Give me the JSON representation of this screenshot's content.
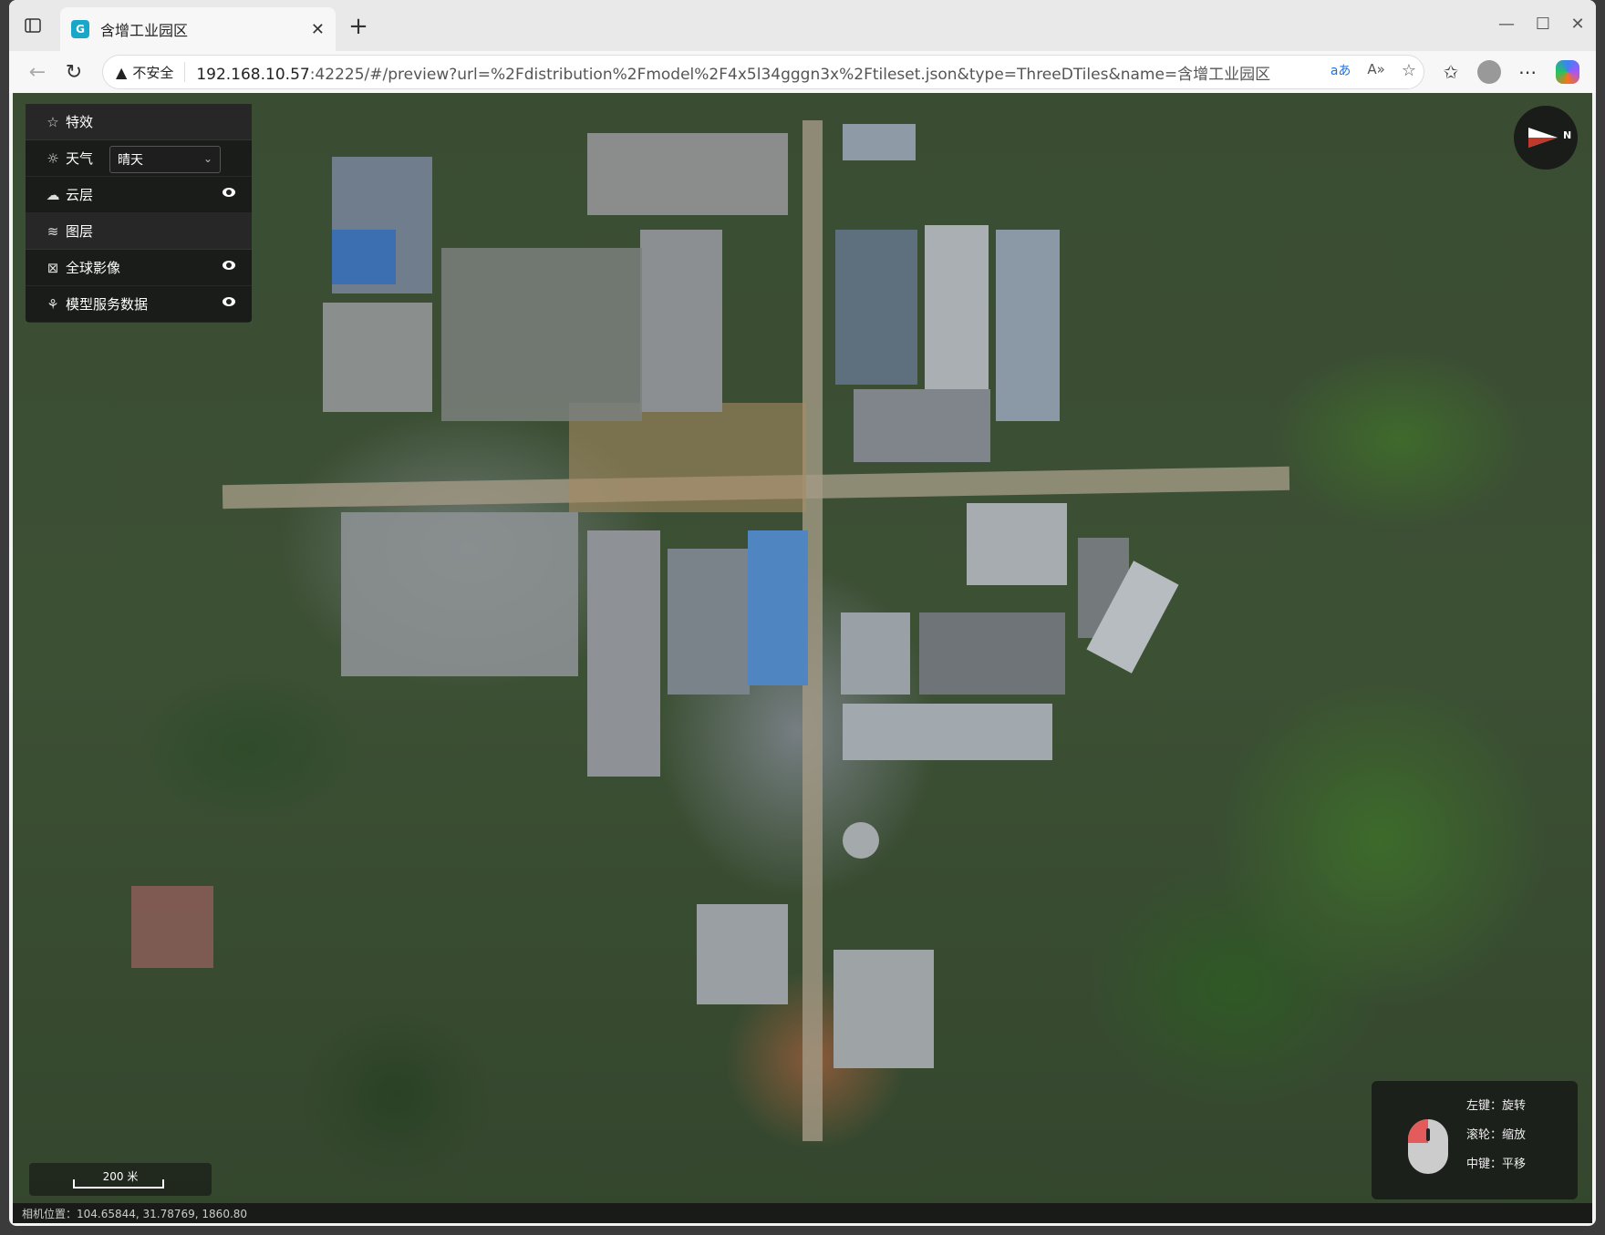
{
  "tab": {
    "title": "含增工业园区",
    "favicon": "G"
  },
  "address": {
    "security_label": "不安全",
    "url_host": "192.168.10.57",
    "url_rest": ":42225/#/preview?url=%2Fdistribution%2Fmodel%2F4x5l34gggn3x%2Ftileset.json&type=ThreeDTiles&name=含增工业园区"
  },
  "panel": {
    "effects_label": "特效",
    "weather_label": "天气",
    "weather_value": "晴天",
    "clouds_label": "云层",
    "layers_label": "图层",
    "imagery_label": "全球影像",
    "model_label": "模型服务数据"
  },
  "compass": {
    "north": "N"
  },
  "help": {
    "left": "左键：旋转",
    "wheel": "滚轮：缩放",
    "middle": "中键：平移"
  },
  "scale": {
    "label": "200 米"
  },
  "status": {
    "camera": "相机位置：104.65844, 31.78769, 1860.80"
  },
  "colors": {
    "panel_bg": "#181818",
    "accent_red": "#e35b5b"
  }
}
